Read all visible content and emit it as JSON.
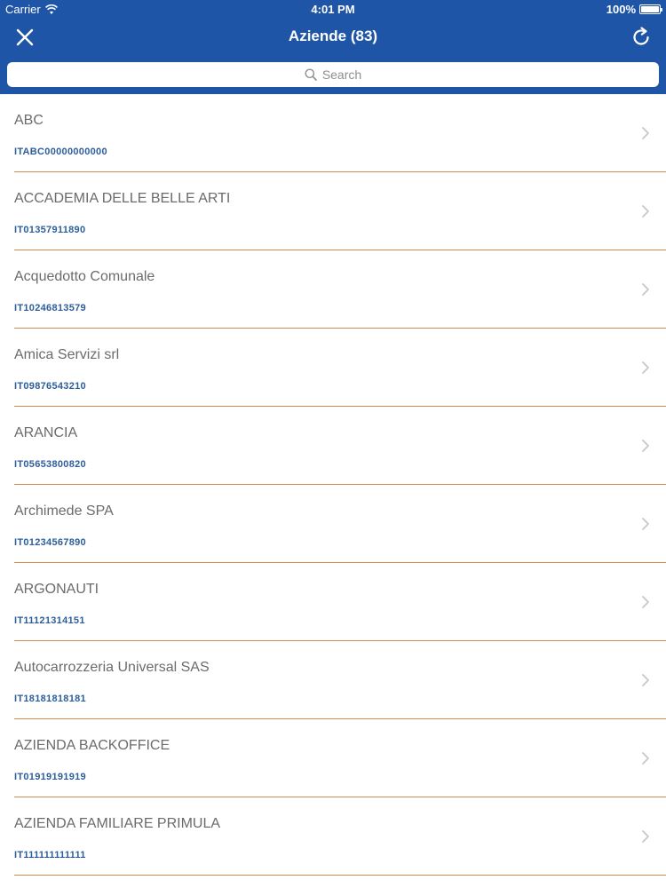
{
  "status_bar": {
    "carrier": "Carrier",
    "time": "4:01 PM",
    "battery": "100%",
    "battery_level": 1.0
  },
  "nav": {
    "title": "Aziende (83)",
    "close_icon": "close-icon",
    "refresh_icon": "refresh-icon"
  },
  "search": {
    "placeholder": "Search"
  },
  "colors": {
    "header_bg": "#1f55a7",
    "code_text": "#2d5e9c",
    "divider": "#d08a52"
  },
  "companies": [
    {
      "name": "ABC",
      "code": "ITABC00000000000"
    },
    {
      "name": "ACCADEMIA DELLE BELLE ARTI",
      "code": "IT01357911890"
    },
    {
      "name": "Acquedotto Comunale",
      "code": "IT10246813579"
    },
    {
      "name": "Amica Servizi srl",
      "code": "IT09876543210"
    },
    {
      "name": "ARANCIA",
      "code": "IT05653800820"
    },
    {
      "name": "Archimede SPA",
      "code": "IT01234567890"
    },
    {
      "name": "ARGONAUTI",
      "code": "IT11121314151"
    },
    {
      "name": "Autocarrozzeria Universal SAS",
      "code": "IT18181818181"
    },
    {
      "name": "AZIENDA BACKOFFICE",
      "code": "IT01919191919"
    },
    {
      "name": "AZIENDA FAMILIARE PRIMULA",
      "code": "IT111111111111"
    }
  ]
}
